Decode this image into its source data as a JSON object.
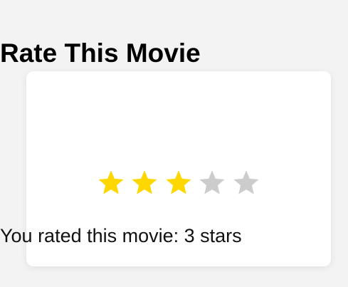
{
  "card": {
    "title": "Rate This Movie",
    "result_text": "You rated this movie: 3 stars"
  },
  "rating": {
    "value": 3,
    "max": 5,
    "icon": "star-icon",
    "filled_color": "#FFD700",
    "empty_color": "#CCCCCC"
  }
}
